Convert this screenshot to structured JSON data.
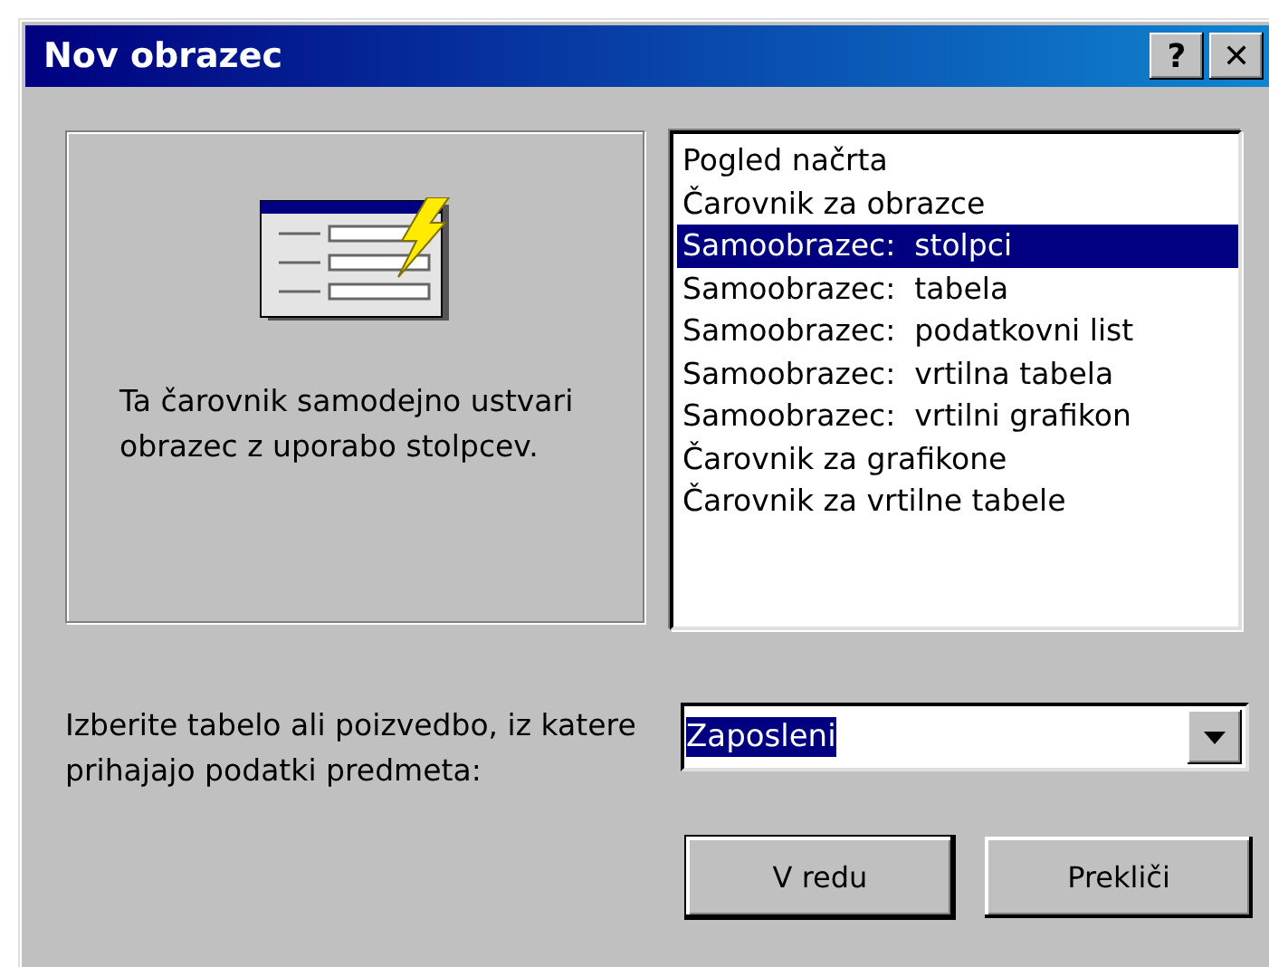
{
  "window": {
    "title": "Nov obrazec",
    "title_buttons": [
      "?",
      "✕"
    ]
  },
  "preview": {
    "description": "Ta čarovnik samodejno ustvari obrazec z uporabo stolpcev."
  },
  "options": [
    {
      "label": "Pogled načrta",
      "selected": false
    },
    {
      "label": "Čarovnik za obrazce",
      "selected": false
    },
    {
      "label": "Samoobrazec:  stolpci",
      "selected": true
    },
    {
      "label": "Samoobrazec:  tabela",
      "selected": false
    },
    {
      "label": "Samoobrazec:  podatkovni list",
      "selected": false
    },
    {
      "label": "Samoobrazec:  vrtilna tabela",
      "selected": false
    },
    {
      "label": "Samoobrazec:  vrtilni grafikon",
      "selected": false
    },
    {
      "label": "Čarovnik za grafikone",
      "selected": false
    },
    {
      "label": "Čarovnik za vrtilne tabele",
      "selected": false
    }
  ],
  "source": {
    "label": "Izberite tabelo ali poizvedbo, iz katere prihajajo podatki predmeta:",
    "value": "Zaposleni",
    "value_highlighted": true
  },
  "buttons": [
    "V redu",
    "Prekliči"
  ]
}
